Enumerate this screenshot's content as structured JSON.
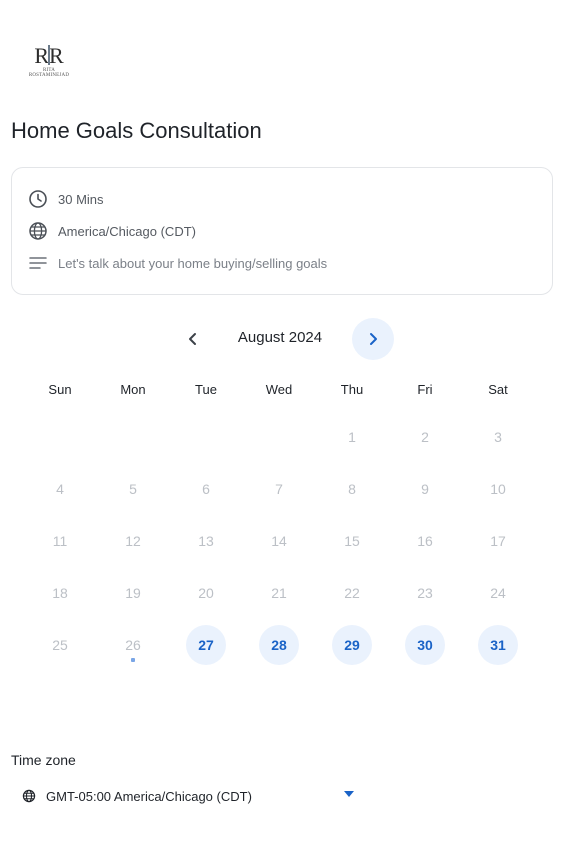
{
  "brand": {
    "logo_initials": "RR",
    "logo_text": "RITA ROSTAMINEJAD"
  },
  "event": {
    "title": "Home Goals Consultation",
    "duration": "30 Mins",
    "timezone": "America/Chicago (CDT)",
    "description": "Let's talk about your home buying/selling goals"
  },
  "calendar": {
    "month_label": "August 2024",
    "weekdays": [
      "Sun",
      "Mon",
      "Tue",
      "Wed",
      "Thu",
      "Fri",
      "Sat"
    ],
    "weeks": [
      [
        "",
        "",
        "",
        "",
        "1",
        "2",
        "3"
      ],
      [
        "4",
        "5",
        "6",
        "7",
        "8",
        "9",
        "10"
      ],
      [
        "11",
        "12",
        "13",
        "14",
        "15",
        "16",
        "17"
      ],
      [
        "18",
        "19",
        "20",
        "21",
        "22",
        "23",
        "24"
      ],
      [
        "25",
        "26",
        "27",
        "28",
        "29",
        "30",
        "31"
      ]
    ],
    "available_days": [
      "27",
      "28",
      "29",
      "30",
      "31"
    ],
    "today": "26"
  },
  "timezone_section": {
    "label": "Time zone",
    "selected": "GMT-05:00 America/Chicago (CDT)"
  },
  "colors": {
    "accent": "#1a63c7",
    "available_bg": "#eaf2fd",
    "disabled_text": "#bcc0c6"
  }
}
